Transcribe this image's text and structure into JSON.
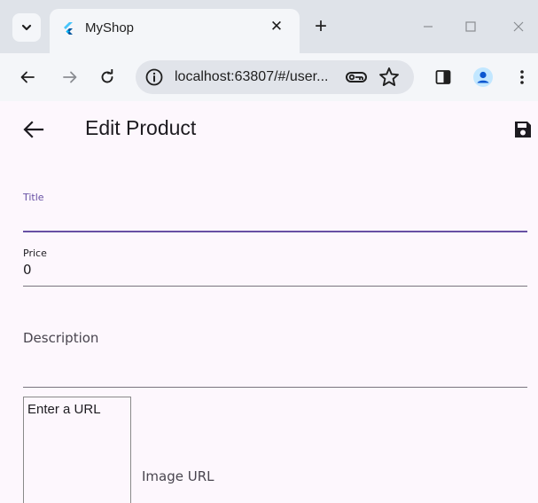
{
  "browser": {
    "tab": {
      "title": "MyShop",
      "close_glyph": "✕"
    },
    "newtab_glyph": "+",
    "url": "localhost:63807/#/user...",
    "icons": {
      "tab_search": "chevron-down-icon",
      "favicon": "flutter-icon",
      "back": "arrow-left-icon",
      "forward": "arrow-right-icon",
      "reload": "reload-icon",
      "site_info": "info-icon",
      "passwords": "key-icon",
      "bookmark": "star-icon",
      "side_panel": "side-panel-icon",
      "profile": "profile-icon",
      "menu": "more-vert-icon"
    },
    "colors": {
      "accent": "#0b57d0",
      "profile_bg": "#c2e7ff"
    }
  },
  "app": {
    "title": "Edit Product",
    "back_icon": "arrow-back-icon",
    "save_icon": "save-icon",
    "background": "#fdf7fd",
    "accent": "#6750a4",
    "form": {
      "title_label": "Title",
      "title_value": "",
      "price_label": "Price",
      "price_value": "0",
      "description_label": "Description",
      "description_value": "",
      "image_preview_text": "Enter a URL",
      "image_url_label": "Image URL"
    }
  }
}
